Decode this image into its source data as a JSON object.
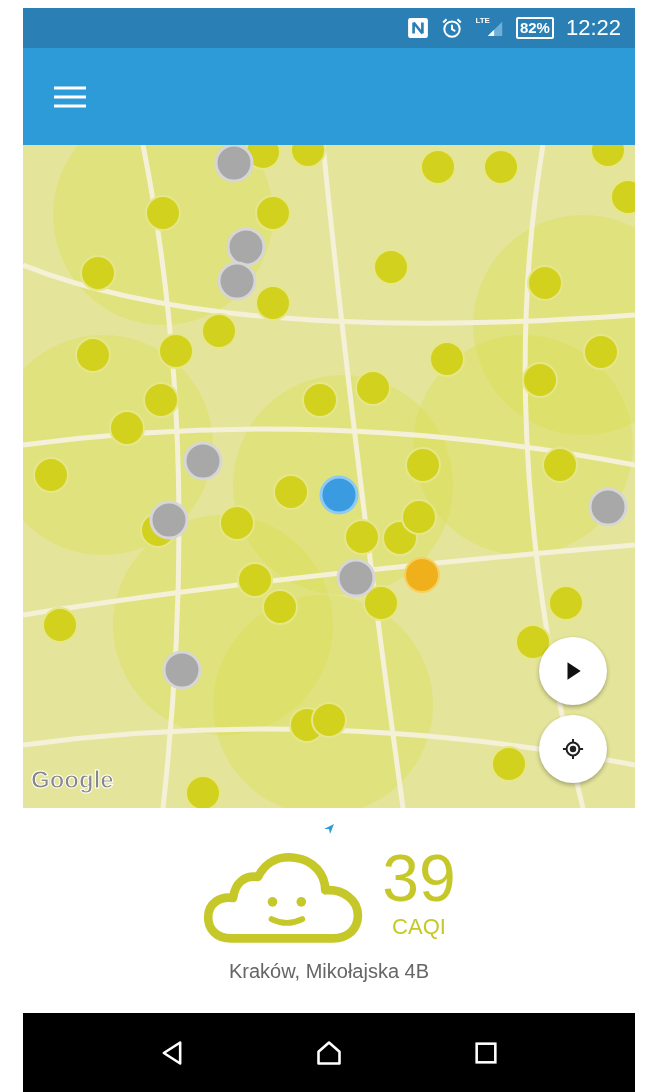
{
  "status_bar": {
    "network": "LTE",
    "battery": "82%",
    "time": "12:22"
  },
  "map": {
    "attribution": "Google"
  },
  "reading": {
    "value": "39",
    "unit": "CAQI",
    "location": "Kraków, Mikołajska 4B"
  }
}
